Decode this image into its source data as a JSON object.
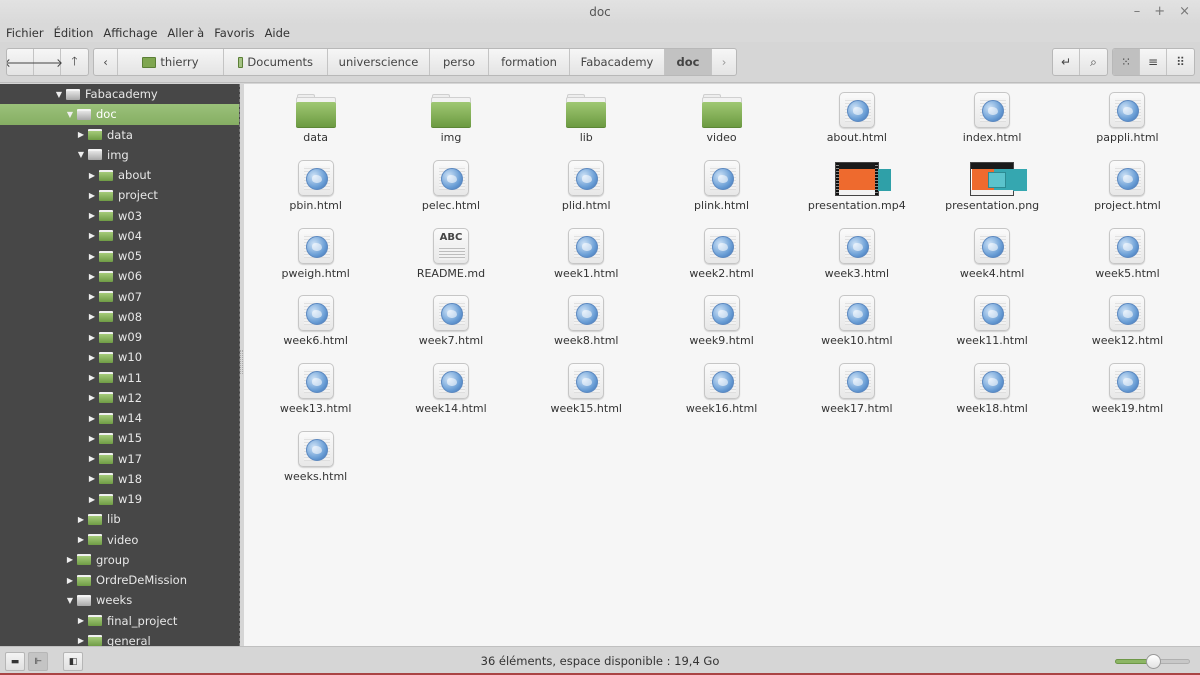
{
  "window": {
    "title": "doc",
    "controls": {
      "minimize": "–",
      "maximize": "+",
      "close": "×"
    }
  },
  "menu": [
    "Fichier",
    "Édition",
    "Affichage",
    "Aller à",
    "Favoris",
    "Aide"
  ],
  "toolbar": {
    "nav": {
      "back": "🡐",
      "forward": "🡒",
      "up": "🡑"
    },
    "crumb_prev": "‹",
    "crumb_next": "›",
    "breadcrumbs": [
      {
        "label": "thierry",
        "icon": "home-folder-icon"
      },
      {
        "label": "Documents",
        "icon": "documents-folder-icon"
      },
      {
        "label": "universcience"
      },
      {
        "label": "perso"
      },
      {
        "label": "formation"
      },
      {
        "label": "Fabacademy"
      },
      {
        "label": "doc",
        "current": true
      }
    ],
    "tools": {
      "location": "↵",
      "search": "⌕"
    },
    "views": {
      "icons": "⁙",
      "list": "≡",
      "compact": "⠿"
    }
  },
  "sidebar": {
    "tree": [
      {
        "label": "Fabacademy",
        "depth": 0,
        "expanded": true,
        "color": "grey"
      },
      {
        "label": "doc",
        "depth": 1,
        "expanded": true,
        "color": "grey",
        "selected": true
      },
      {
        "label": "data",
        "depth": 2,
        "expanded": false,
        "color": "green"
      },
      {
        "label": "img",
        "depth": 2,
        "expanded": true,
        "color": "grey"
      },
      {
        "label": "about",
        "depth": 3,
        "expanded": false,
        "color": "green"
      },
      {
        "label": "project",
        "depth": 3,
        "expanded": false,
        "color": "green"
      },
      {
        "label": "w03",
        "depth": 3,
        "expanded": false,
        "color": "green"
      },
      {
        "label": "w04",
        "depth": 3,
        "expanded": false,
        "color": "green"
      },
      {
        "label": "w05",
        "depth": 3,
        "expanded": false,
        "color": "green"
      },
      {
        "label": "w06",
        "depth": 3,
        "expanded": false,
        "color": "green"
      },
      {
        "label": "w07",
        "depth": 3,
        "expanded": false,
        "color": "green"
      },
      {
        "label": "w08",
        "depth": 3,
        "expanded": false,
        "color": "green"
      },
      {
        "label": "w09",
        "depth": 3,
        "expanded": false,
        "color": "green"
      },
      {
        "label": "w10",
        "depth": 3,
        "expanded": false,
        "color": "green"
      },
      {
        "label": "w11",
        "depth": 3,
        "expanded": false,
        "color": "green"
      },
      {
        "label": "w12",
        "depth": 3,
        "expanded": false,
        "color": "green"
      },
      {
        "label": "w14",
        "depth": 3,
        "expanded": false,
        "color": "green"
      },
      {
        "label": "w15",
        "depth": 3,
        "expanded": false,
        "color": "green"
      },
      {
        "label": "w17",
        "depth": 3,
        "expanded": false,
        "color": "green"
      },
      {
        "label": "w18",
        "depth": 3,
        "expanded": false,
        "color": "green"
      },
      {
        "label": "w19",
        "depth": 3,
        "expanded": false,
        "color": "green"
      },
      {
        "label": "lib",
        "depth": 2,
        "expanded": false,
        "color": "green"
      },
      {
        "label": "video",
        "depth": 2,
        "expanded": false,
        "color": "green"
      },
      {
        "label": "group",
        "depth": 1,
        "expanded": false,
        "color": "green"
      },
      {
        "label": "OrdreDeMission",
        "depth": 1,
        "expanded": false,
        "color": "green"
      },
      {
        "label": "weeks",
        "depth": 1,
        "expanded": true,
        "color": "grey"
      },
      {
        "label": "final_project",
        "depth": 2,
        "expanded": false,
        "color": "green"
      },
      {
        "label": "general",
        "depth": 2,
        "expanded": false,
        "color": "green"
      }
    ]
  },
  "files": [
    {
      "name": "data",
      "type": "folder"
    },
    {
      "name": "img",
      "type": "folder"
    },
    {
      "name": "lib",
      "type": "folder"
    },
    {
      "name": "video",
      "type": "folder"
    },
    {
      "name": "about.html",
      "type": "html"
    },
    {
      "name": "index.html",
      "type": "html"
    },
    {
      "name": "pappli.html",
      "type": "html"
    },
    {
      "name": "pbin.html",
      "type": "html"
    },
    {
      "name": "pelec.html",
      "type": "html"
    },
    {
      "name": "plid.html",
      "type": "html"
    },
    {
      "name": "plink.html",
      "type": "html"
    },
    {
      "name": "presentation.mp4",
      "type": "video"
    },
    {
      "name": "presentation.png",
      "type": "image"
    },
    {
      "name": "project.html",
      "type": "html"
    },
    {
      "name": "pweigh.html",
      "type": "html"
    },
    {
      "name": "README.md",
      "type": "text",
      "icon_text": "ABC"
    },
    {
      "name": "week1.html",
      "type": "html"
    },
    {
      "name": "week2.html",
      "type": "html"
    },
    {
      "name": "week3.html",
      "type": "html"
    },
    {
      "name": "week4.html",
      "type": "html"
    },
    {
      "name": "week5.html",
      "type": "html"
    },
    {
      "name": "week6.html",
      "type": "html"
    },
    {
      "name": "week7.html",
      "type": "html"
    },
    {
      "name": "week8.html",
      "type": "html"
    },
    {
      "name": "week9.html",
      "type": "html"
    },
    {
      "name": "week10.html",
      "type": "html"
    },
    {
      "name": "week11.html",
      "type": "html"
    },
    {
      "name": "week12.html",
      "type": "html"
    },
    {
      "name": "week13.html",
      "type": "html"
    },
    {
      "name": "week14.html",
      "type": "html"
    },
    {
      "name": "week15.html",
      "type": "html"
    },
    {
      "name": "week16.html",
      "type": "html"
    },
    {
      "name": "week17.html",
      "type": "html"
    },
    {
      "name": "week18.html",
      "type": "html"
    },
    {
      "name": "week19.html",
      "type": "html"
    },
    {
      "name": "weeks.html",
      "type": "html"
    }
  ],
  "statusbar": {
    "text": "36 éléments, espace disponible : 19,4 Go",
    "buttons": {
      "places": "▬",
      "tree": "⊩",
      "toggle_sidebar": "◧"
    },
    "zoom_level": 0.5
  },
  "colors": {
    "accent": "#8db665",
    "sidebar_bg": "#474747",
    "content_bg": "#f6f6f6"
  }
}
